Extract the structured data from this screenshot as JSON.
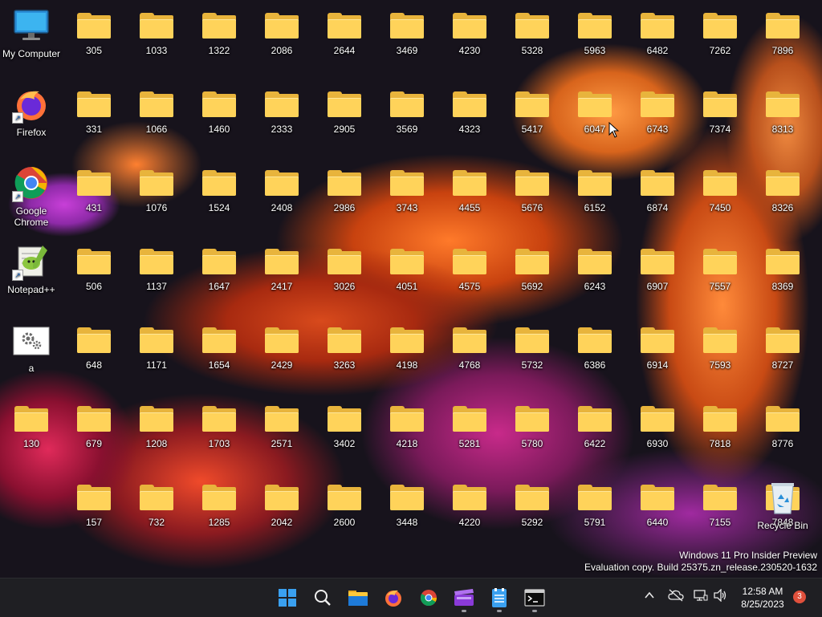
{
  "desktop": {
    "shortcuts": [
      {
        "name": "my-computer",
        "label": "My Computer"
      },
      {
        "name": "firefox",
        "label": "Firefox"
      },
      {
        "name": "google-chrome",
        "label": "Google Chrome"
      },
      {
        "name": "notepad-plus-plus",
        "label": "Notepad++"
      },
      {
        "name": "a",
        "label": "a"
      }
    ],
    "recycle_bin": {
      "label": "Recycle Bin"
    },
    "folder_rows": [
      [
        "305",
        "1033",
        "1322",
        "2086",
        "2644",
        "3469",
        "4230",
        "5328",
        "5963",
        "6482",
        "7262",
        "7896"
      ],
      [
        "331",
        "1066",
        "1460",
        "2333",
        "2905",
        "3569",
        "4323",
        "5417",
        "6047",
        "6743",
        "7374",
        "8313"
      ],
      [
        "431",
        "1076",
        "1524",
        "2408",
        "2986",
        "3743",
        "4455",
        "5676",
        "6152",
        "6874",
        "7450",
        "8326"
      ],
      [
        "506",
        "1137",
        "1647",
        "2417",
        "3026",
        "4051",
        "4575",
        "5692",
        "6243",
        "6907",
        "7557",
        "8369"
      ],
      [
        "648",
        "1171",
        "1654",
        "2429",
        "3263",
        "4198",
        "4768",
        "5732",
        "6386",
        "6914",
        "7593",
        "8727"
      ],
      [
        "130",
        "679",
        "1208",
        "1703",
        "2571",
        "3402",
        "4218",
        "5281",
        "5780",
        "6422",
        "6930",
        "7818",
        "8776"
      ],
      [
        "157",
        "732",
        "1285",
        "2042",
        "2600",
        "3448",
        "4220",
        "5292",
        "5791",
        "6440",
        "7155",
        "7848"
      ]
    ]
  },
  "watermark": {
    "line1": "Windows 11 Pro Insider Preview",
    "line2": "Evaluation copy. Build 25375.zn_release.230520-1632"
  },
  "taskbar": {
    "apps": [
      {
        "name": "start-button",
        "icon": "windows-logo-icon"
      },
      {
        "name": "search-button",
        "icon": "search-icon"
      },
      {
        "name": "file-explorer-button",
        "icon": "folder-icon"
      },
      {
        "name": "firefox-taskbar-button",
        "icon": "firefox-icon"
      },
      {
        "name": "chrome-taskbar-button",
        "icon": "chrome-icon"
      },
      {
        "name": "clapper-taskbar-button",
        "icon": "clapperboard-icon"
      },
      {
        "name": "notepad-taskbar-button",
        "icon": "notepad-icon"
      },
      {
        "name": "terminal-taskbar-button",
        "icon": "terminal-icon"
      }
    ],
    "clock": {
      "time": "12:58 AM",
      "date": "8/25/2023"
    },
    "notification_count": "3"
  }
}
